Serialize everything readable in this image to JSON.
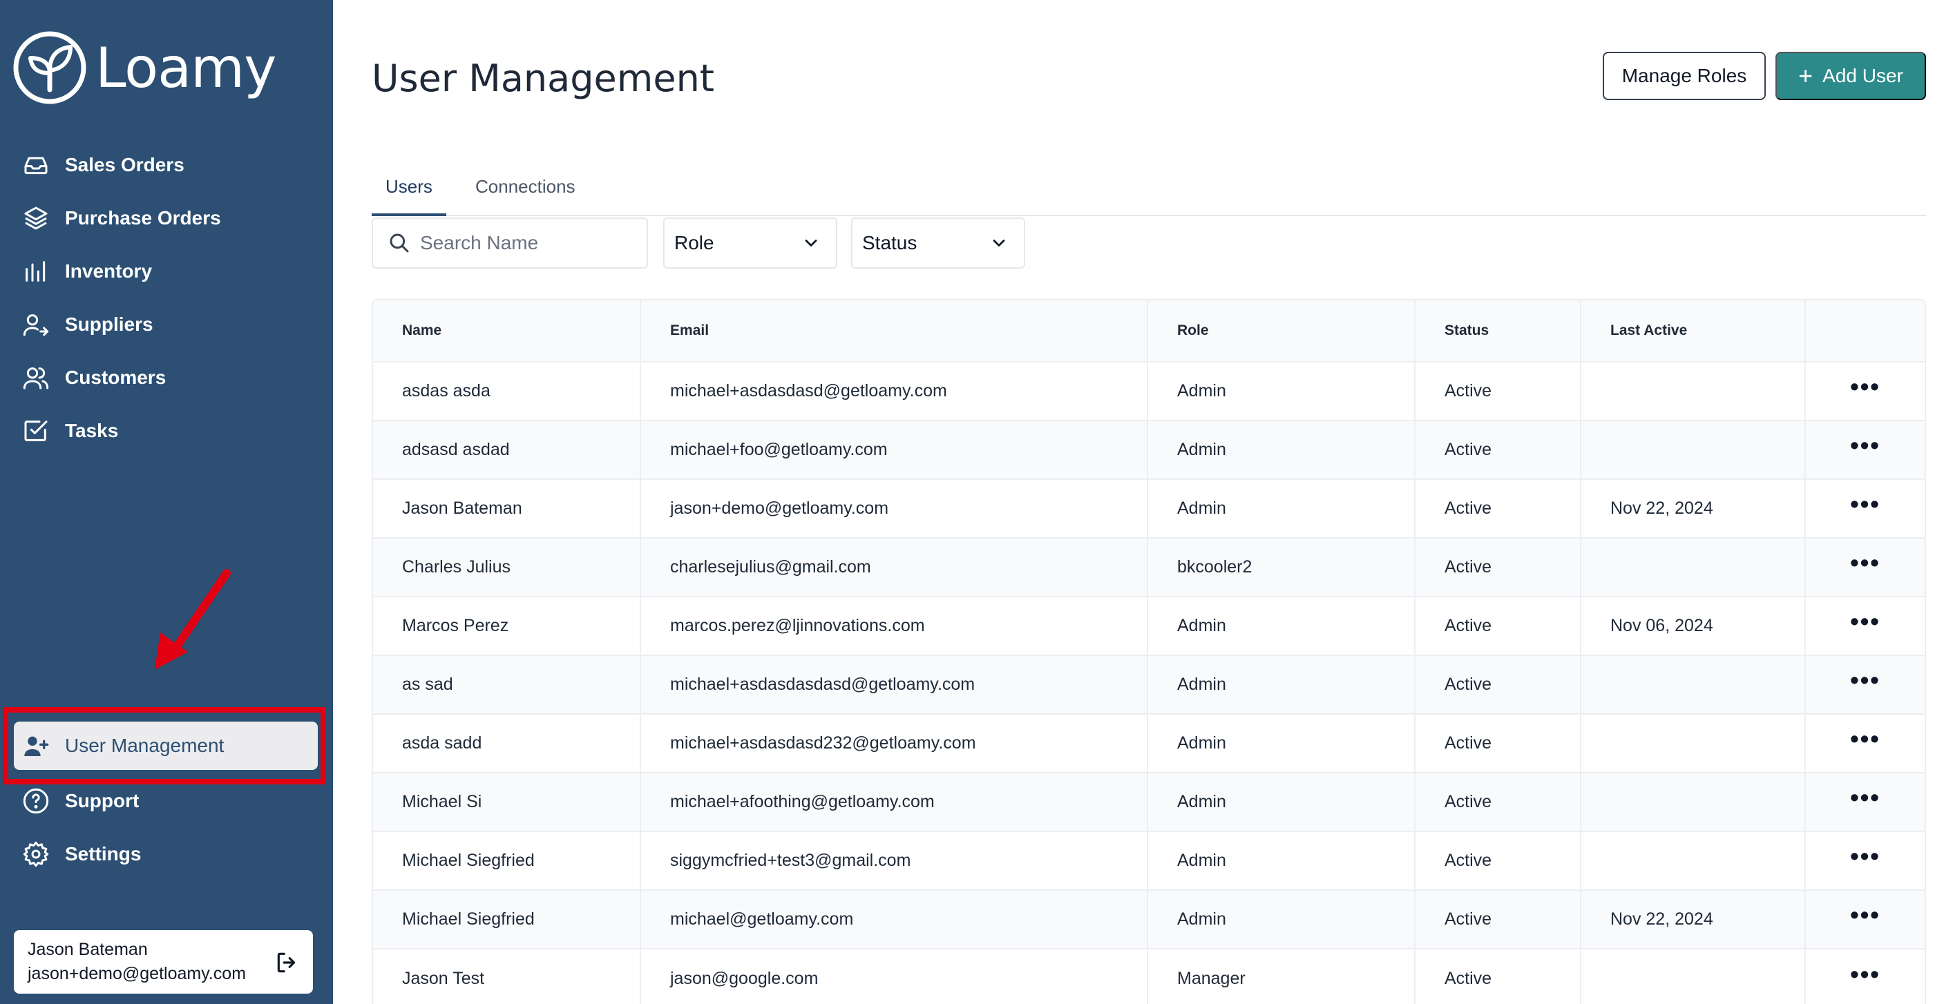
{
  "app": {
    "brand": "Loamy"
  },
  "sidebar": {
    "nav": [
      {
        "label": "Sales Orders",
        "icon": "inbox-icon"
      },
      {
        "label": "Purchase Orders",
        "icon": "layers-icon"
      },
      {
        "label": "Inventory",
        "icon": "bar-chart-icon"
      },
      {
        "label": "Suppliers",
        "icon": "user-arrow-icon"
      },
      {
        "label": "Customers",
        "icon": "users-icon"
      },
      {
        "label": "Tasks",
        "icon": "check-square-icon"
      }
    ],
    "bottom": [
      {
        "label": "User Management",
        "icon": "user-plus-icon",
        "active": true
      },
      {
        "label": "Support",
        "icon": "help-circle-icon"
      },
      {
        "label": "Settings",
        "icon": "gear-icon"
      }
    ],
    "user": {
      "name": "Jason Bateman",
      "email": "jason+demo@getloamy.com"
    }
  },
  "header": {
    "title": "User Management",
    "manage_roles_label": "Manage Roles",
    "add_user_label": "Add User"
  },
  "tabs": [
    "Users",
    "Connections"
  ],
  "filters": {
    "search_placeholder": "Search Name",
    "role_label": "Role",
    "status_label": "Status"
  },
  "table": {
    "columns": [
      "Name",
      "Email",
      "Role",
      "Status",
      "Last Active",
      ""
    ],
    "rows": [
      [
        "asdas asda",
        "michael+asdasdasd@getloamy.com",
        "Admin",
        "Active",
        ""
      ],
      [
        "adsasd asdad",
        "michael+foo@getloamy.com",
        "Admin",
        "Active",
        ""
      ],
      [
        "Jason Bateman",
        "jason+demo@getloamy.com",
        "Admin",
        "Active",
        "Nov 22, 2024"
      ],
      [
        "Charles Julius",
        "charlesejulius@gmail.com",
        "bkcooler2",
        "Active",
        ""
      ],
      [
        "Marcos Perez",
        "marcos.perez@ljinnovations.com",
        "Admin",
        "Active",
        "Nov 06, 2024"
      ],
      [
        "as sad",
        "michael+asdasdasdasd@getloamy.com",
        "Admin",
        "Active",
        ""
      ],
      [
        "asda sadd",
        "michael+asdasdasd232@getloamy.com",
        "Admin",
        "Active",
        ""
      ],
      [
        "Michael Si",
        "michael+afoothing@getloamy.com",
        "Admin",
        "Active",
        ""
      ],
      [
        "Michael Siegfried",
        "siggymcfried+test3@gmail.com",
        "Admin",
        "Active",
        ""
      ],
      [
        "Michael Siegfried",
        "michael@getloamy.com",
        "Admin",
        "Active",
        "Nov 22, 2024"
      ],
      [
        "Jason Test",
        "jason@google.com",
        "Manager",
        "Active",
        ""
      ]
    ],
    "row_action_label": "•••"
  },
  "colors": {
    "sidebar": "#2c4f73",
    "accent": "#2d8a8a",
    "highlight": "#e00012"
  }
}
